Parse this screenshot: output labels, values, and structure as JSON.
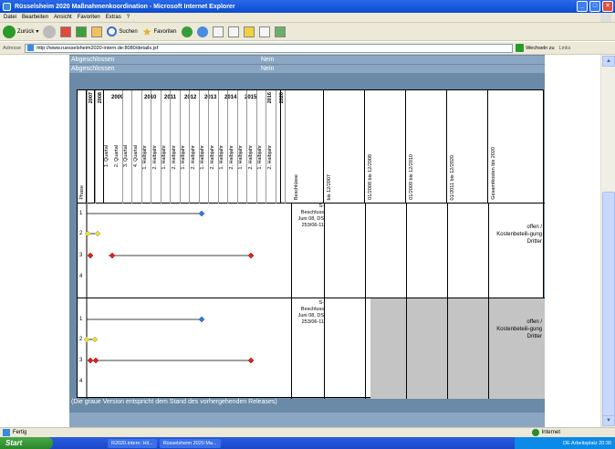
{
  "window": {
    "title": "Rüsselsheim 2020 Maßnahmenkoordination - Microsoft Internet Explorer"
  },
  "menu": [
    "Datei",
    "Bearbeiten",
    "Ansicht",
    "Favoriten",
    "Extras",
    "?"
  ],
  "toolbar": {
    "back": "Zurück",
    "search": "Suchen",
    "favorites": "Favoriten"
  },
  "address": {
    "label": "Adresse",
    "url": "http://www.ruesselsheim2020-intern.de:8080/details.jsf",
    "go": "Wechseln zu",
    "links": "Links"
  },
  "top_rows": [
    {
      "label": "Abgeschlossen",
      "value": "Nein"
    },
    {
      "label": "Abgeschlossen",
      "value": "Nein"
    }
  ],
  "header": {
    "phase": "Phase",
    "years": [
      "2007",
      "2008",
      "2009",
      "2010",
      "2011",
      "2012",
      "2013",
      "2014",
      "2015",
      "2016",
      "2020"
    ],
    "periods": [
      "1. Quartal",
      "2. Quartal",
      "3. Quartal",
      "4. Quartal",
      "1. Halbjahr",
      "2. Halbjahr",
      "1. Halbjahr",
      "2. Halbjahr",
      "1. Halbjahr",
      "2. Halbjahr",
      "1. Halbjahr",
      "2. Halbjahr",
      "1. Halbjahr",
      "2. Halbjahr",
      "1. Halbjahr",
      "2. Halbjahr",
      "1. Halbjahr",
      "2. Halbjahr"
    ],
    "cols": [
      "Beschlüsse",
      "bis 12/2007",
      "01/2008 bis 12/2008",
      "01/2009 bis 12/2010",
      "01/2011 bis 12/2020",
      "Gesamtkosten bis 2020"
    ]
  },
  "sections": [
    {
      "phases": [
        "1",
        "2",
        "3",
        "4"
      ],
      "beschluss": "S-\nBeschluss\nJuni 08, DS\n253/06-11",
      "gesamt": "offen /\nKostenbeteili-gung\nDritter"
    },
    {
      "phases": [
        "1",
        "2",
        "3",
        "4"
      ],
      "beschluss": "S-\nBeschluss\nJuni 08, DS\n253/06-11",
      "gesamt": "offen /\nKostenbeteili-gung\nDritter"
    }
  ],
  "note": "(Die graue Version entspricht dem Stand des vorhergehenden Releases)",
  "colors": {
    "diamond_blue": "#2f7de0",
    "diamond_yellow": "#f0e020",
    "diamond_red": "#e0201c"
  },
  "status": {
    "left": "Fertig",
    "zone": "Internet"
  },
  "taskbar": {
    "start": "Start",
    "apps": [
      "R2020.intern: Hil...",
      "Rüsselsheim 2020 Ma..."
    ],
    "tray": "DE   Arbeitsplatz   20:30"
  }
}
